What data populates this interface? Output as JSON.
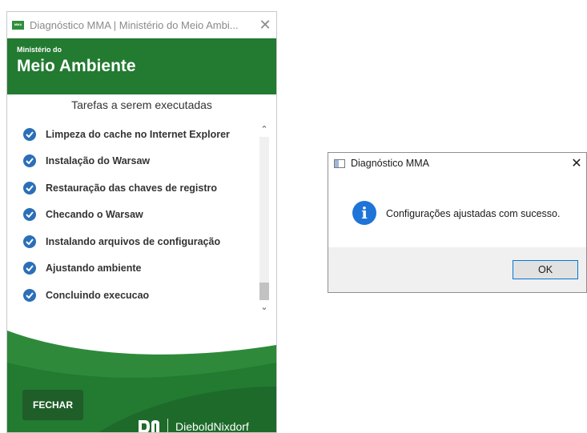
{
  "main_window": {
    "icon_label": "MMA",
    "title": "Diagnóstico MMA | Ministério do Meio Ambi...",
    "close_glyph": "✕",
    "header_small": "Ministério do",
    "header_big": "Meio Ambiente",
    "tasks_title": "Tarefas a serem executadas",
    "tasks": [
      {
        "label": "Limpeza do cache no Internet Explorer",
        "status": "done"
      },
      {
        "label": "Instalação do Warsaw",
        "status": "done"
      },
      {
        "label": "Restauração das chaves de registro",
        "status": "done"
      },
      {
        "label": "Checando o Warsaw",
        "status": "done"
      },
      {
        "label": "Instalando arquivos de configuração",
        "status": "done"
      },
      {
        "label": "Ajustando ambiente",
        "status": "done"
      },
      {
        "label": "Concluindo execucao",
        "status": "done"
      }
    ],
    "close_button": "FECHAR",
    "brand": "DieboldNixdorf",
    "colors": {
      "green": "#237a31",
      "dark_green": "#1f5e28",
      "check_blue": "#2b6fb8"
    }
  },
  "dialog": {
    "title": "Diagnóstico MMA",
    "close_glyph": "✕",
    "message": "Configurações ajustadas com sucesso.",
    "ok_button": "OK",
    "icon": "info-icon",
    "colors": {
      "info_blue": "#1f74d8",
      "button_border": "#0078d7"
    }
  }
}
